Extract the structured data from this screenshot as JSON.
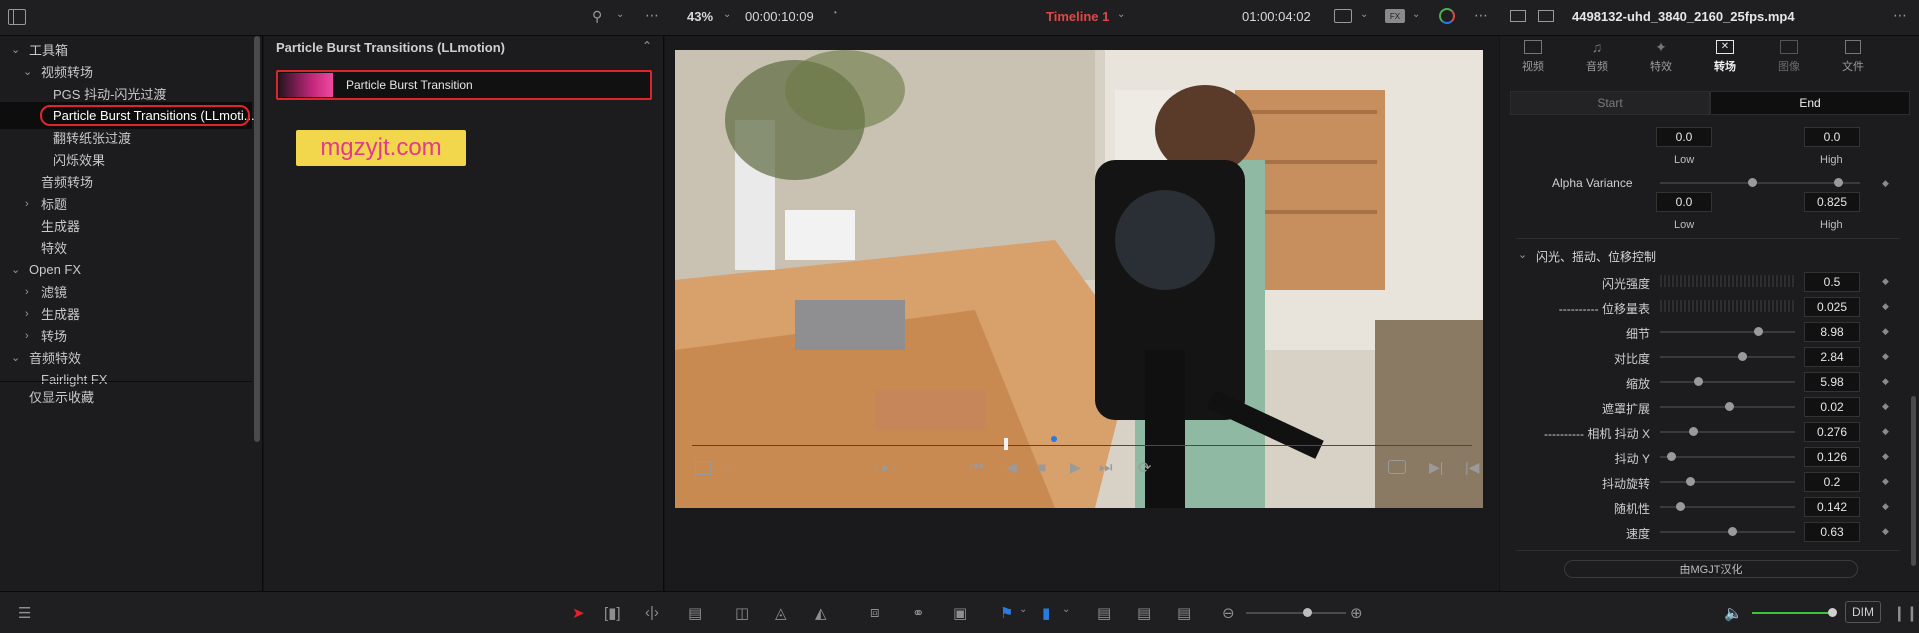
{
  "topbar": {
    "zoom": "43%",
    "timecode_left": "00:00:10:09",
    "timeline_name": "Timeline 1",
    "timecode_right": "01:00:04:02",
    "clip_name": "4498132-uhd_3840_2160_25fps.mp4"
  },
  "toolbox": {
    "items": [
      {
        "label": "工具箱"
      },
      {
        "label": "视频转场"
      },
      {
        "label": "PGS 抖动-闪光过渡"
      },
      {
        "label": "Particle Burst Transitions (LLmoti..."
      },
      {
        "label": "翻转纸张过渡"
      },
      {
        "label": "闪烁效果"
      },
      {
        "label": "音频转场"
      },
      {
        "label": "标题"
      },
      {
        "label": "生成器"
      },
      {
        "label": "特效"
      },
      {
        "label": "Open FX"
      },
      {
        "label": "滤镜"
      },
      {
        "label": "生成器"
      },
      {
        "label": "转场"
      },
      {
        "label": "音频特效"
      },
      {
        "label": "Fairlight FX"
      }
    ],
    "favorites_label": "仅显示收藏"
  },
  "effects_panel": {
    "title": "Particle Burst Transitions (LLmotion)",
    "item_label": "Particle Burst Transition",
    "watermark": "mgzyjt.com"
  },
  "inspector": {
    "tabs": [
      {
        "label": "视频"
      },
      {
        "label": "音频"
      },
      {
        "label": "特效"
      },
      {
        "label": "转场"
      },
      {
        "label": "图像"
      },
      {
        "label": "文件"
      }
    ],
    "start_label": "Start",
    "end_label": "End",
    "top_low_val": "0.0",
    "top_high_val": "0.0",
    "low_label": "Low",
    "high_label": "High",
    "alpha_label": "Alpha Variance",
    "alpha_low_val": "0.0",
    "alpha_high_val": "0.825",
    "section_title": "闪光、摇动、位移控制",
    "params": [
      {
        "label": "闪光强度",
        "value": "0.5"
      },
      {
        "label": "---------- 位移量表",
        "value": "0.025"
      },
      {
        "label": "细节",
        "value": "8.98"
      },
      {
        "label": "对比度",
        "value": "2.84"
      },
      {
        "label": "缩放",
        "value": "5.98"
      },
      {
        "label": "遮罩扩展",
        "value": "0.02"
      },
      {
        "label": "---------- 相机 抖动 X",
        "value": "0.276"
      },
      {
        "label": "抖动 Y",
        "value": "0.126"
      },
      {
        "label": "抖动旋转",
        "value": "0.2"
      },
      {
        "label": "随机性",
        "value": "0.142"
      },
      {
        "label": "速度",
        "value": "0.63"
      }
    ],
    "credit_label": "由MGJT汉化"
  },
  "colors": {
    "accent_red": "#e04848",
    "accent_blue": "#2a7be0",
    "volume_green": "#3cc43c"
  }
}
